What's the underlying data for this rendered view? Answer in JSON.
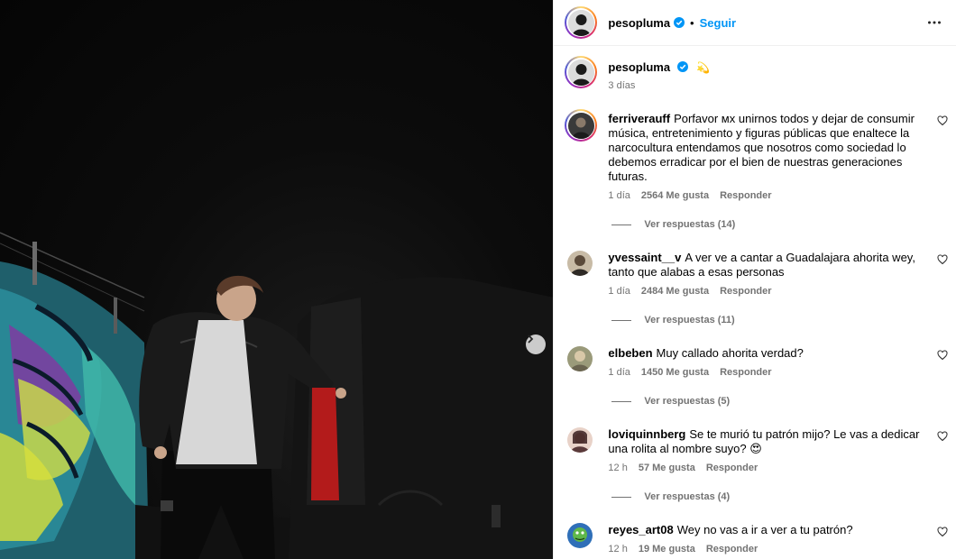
{
  "post": {
    "author": "pesopluma",
    "verified": true,
    "follow_label": "Seguir",
    "header_separator": "•",
    "more_icon": "more-horizontal-icon",
    "caption_emoji": "💫",
    "caption_time": "3 días",
    "next_icon": "chevron-right-icon"
  },
  "colors": {
    "link_blue": "#0095f6",
    "secondary_text": "#737373",
    "verified_blue": "#0095f6"
  },
  "comments": [
    {
      "username": "ferriverauff",
      "text": "Porfavor ᴍx unirnos todos y dejar de consumir música, entretenimiento y figuras públicas que enaltece la narcocultura entendamos que nosotros como sociedad lo debemos erradicar por el bien de nuestras generaciones futuras.",
      "time": "1 día",
      "likes": "2564 Me gusta",
      "reply_label": "Responder",
      "view_replies": "Ver respuestas (14)"
    },
    {
      "username": "yvessaint__v",
      "text": "A ver ve a cantar a Guadalajara ahorita wey, tanto que alabas a esas personas",
      "time": "1 día",
      "likes": "2484 Me gusta",
      "reply_label": "Responder",
      "view_replies": "Ver respuestas (11)"
    },
    {
      "username": "elbeben",
      "text": "Muy callado ahorita verdad?",
      "time": "1 día",
      "likes": "1450 Me gusta",
      "reply_label": "Responder",
      "view_replies": "Ver respuestas (5)"
    },
    {
      "username": "loviquinnberg",
      "text": "Se te murió tu patrón mijo? Le vas a dedicar una rolita al nombre suyo? 😍",
      "time": "12 h",
      "likes": "57 Me gusta",
      "reply_label": "Responder",
      "view_replies": "Ver respuestas (4)"
    },
    {
      "username": "reyes_art08",
      "text": "Wey no vas a ir a ver a tu patrón?",
      "time": "12 h",
      "likes": "19 Me gusta",
      "reply_label": "Responder"
    }
  ]
}
